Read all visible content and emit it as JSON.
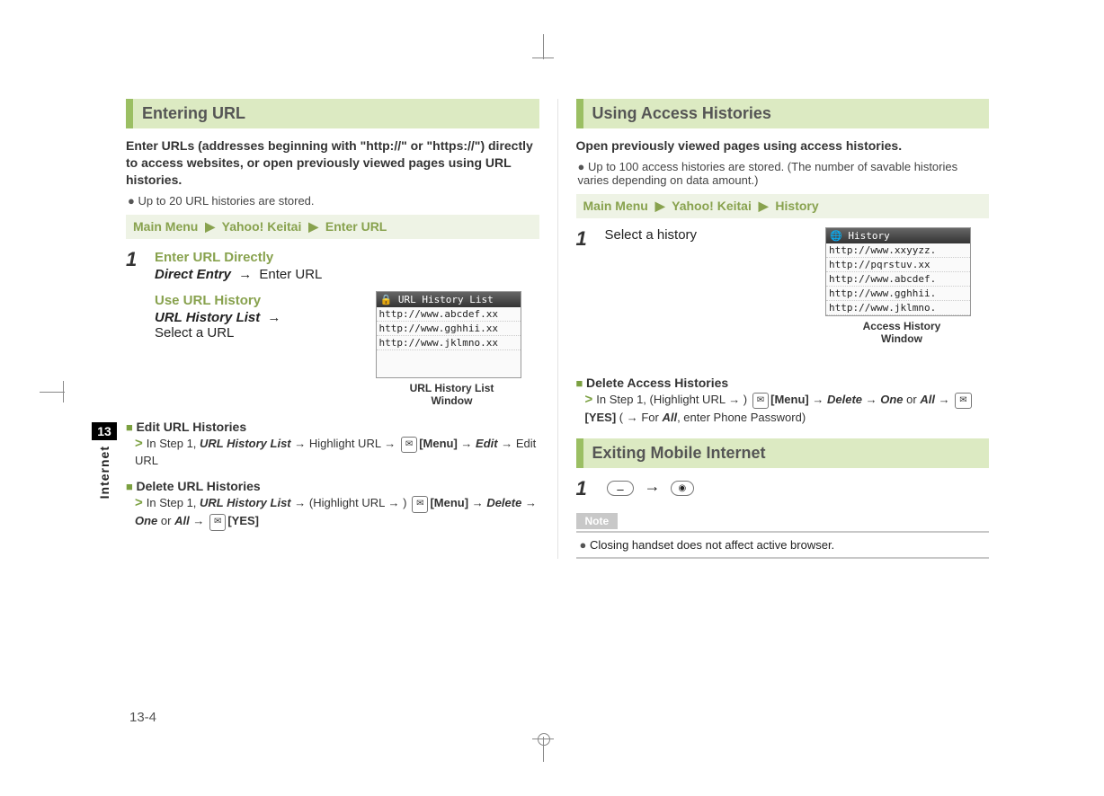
{
  "sidebar": {
    "chapter": "13",
    "label": "Internet"
  },
  "page_number": "13-4",
  "left": {
    "title": "Entering URL",
    "intro": "Enter URLs (addresses beginning with \"http://\" or \"https://\") directly to access websites, or open previously viewed pages using URL histories.",
    "note_bullet": "Up to 20 URL histories are stored.",
    "menu": {
      "a": "Main Menu",
      "b": "Yahoo! Keitai",
      "c": "Enter URL"
    },
    "step1": {
      "num": "1",
      "h1": "Enter URL Directly",
      "l1a": "Direct Entry",
      "l1b": "Enter URL",
      "h2": "Use URL History",
      "l2a": "URL History List",
      "l2b": "Select a URL"
    },
    "shot": {
      "title": "URL History List",
      "lines": [
        "http://www.abcdef.xx",
        "http://www.gghhii.xx",
        "http://www.jklmno.xx"
      ],
      "caption1": "URL History List",
      "caption2": "Window"
    },
    "edit": {
      "head": "Edit URL Histories",
      "text_a": "In Step 1, ",
      "text_b": "URL History List",
      "text_c": " → Highlight URL → ",
      "menu": "[Menu]",
      "text_d": " → ",
      "edit": "Edit",
      "text_e": " → Edit URL"
    },
    "delete": {
      "head": "Delete URL Histories",
      "text_a": "In Step 1, ",
      "text_b": "URL History List",
      "text_c": " → (Highlight URL → ) ",
      "menu": "[Menu]",
      "text_d": " → ",
      "del": "Delete",
      "text_e": " → ",
      "one": "One",
      "or": " or ",
      "all": "All",
      "text_f": " → ",
      "yes": "[YES]"
    }
  },
  "right": {
    "title": "Using Access Histories",
    "intro": "Open previously viewed pages using access histories.",
    "note_bullet": "Up to 100 access histories are stored. (The number of savable histories varies depending on data amount.)",
    "menu": {
      "a": "Main Menu",
      "b": "Yahoo! Keitai",
      "c": "History"
    },
    "step1": {
      "num": "1",
      "text": "Select a history"
    },
    "shot": {
      "title": "History",
      "lines": [
        "http://www.xxyyzz.",
        "http://pqrstuv.xx",
        "http://www.abcdef.",
        "http://www.gghhii.",
        "http://www.jklmno."
      ],
      "caption1": "Access History",
      "caption2": "Window"
    },
    "delete": {
      "head": "Delete Access Histories",
      "text_a": "In Step 1, (Highlight URL → ) ",
      "menu": "[Menu]",
      "text_b": " → ",
      "del": "Delete",
      "text_c": " → ",
      "one": "One",
      "or": " or ",
      "all": "All",
      "text_d": " → ",
      "yes": "[YES]",
      "text_e": " ( → For ",
      "all2": "All",
      "text_f": ", enter Phone Password)"
    },
    "exit": {
      "title": "Exiting Mobile Internet",
      "step_num": "1"
    },
    "note": {
      "tag": "Note",
      "text": "Closing handset does not affect active browser."
    }
  }
}
